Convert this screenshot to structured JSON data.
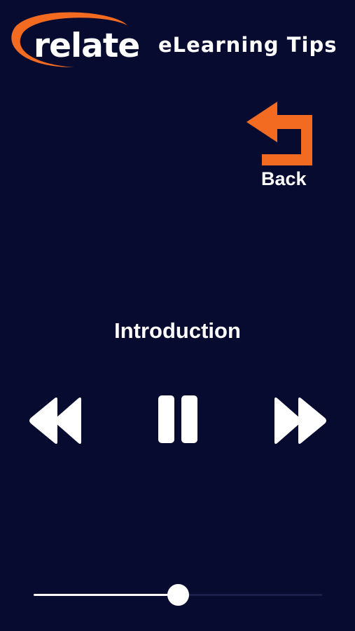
{
  "header": {
    "logo_text": "relate",
    "title": "eLearning Tips"
  },
  "back": {
    "label": "Back",
    "icon": "back-arrow-icon"
  },
  "player": {
    "track_title": "Introduction",
    "controls": {
      "rewind_icon": "rewind-icon",
      "pause_icon": "pause-icon",
      "forward_icon": "fast-forward-icon"
    },
    "progress": 0.5
  },
  "colors": {
    "background": "#070b2f",
    "accent": "#f26b21",
    "text": "#ffffff",
    "track_inactive": "#1c214c"
  }
}
